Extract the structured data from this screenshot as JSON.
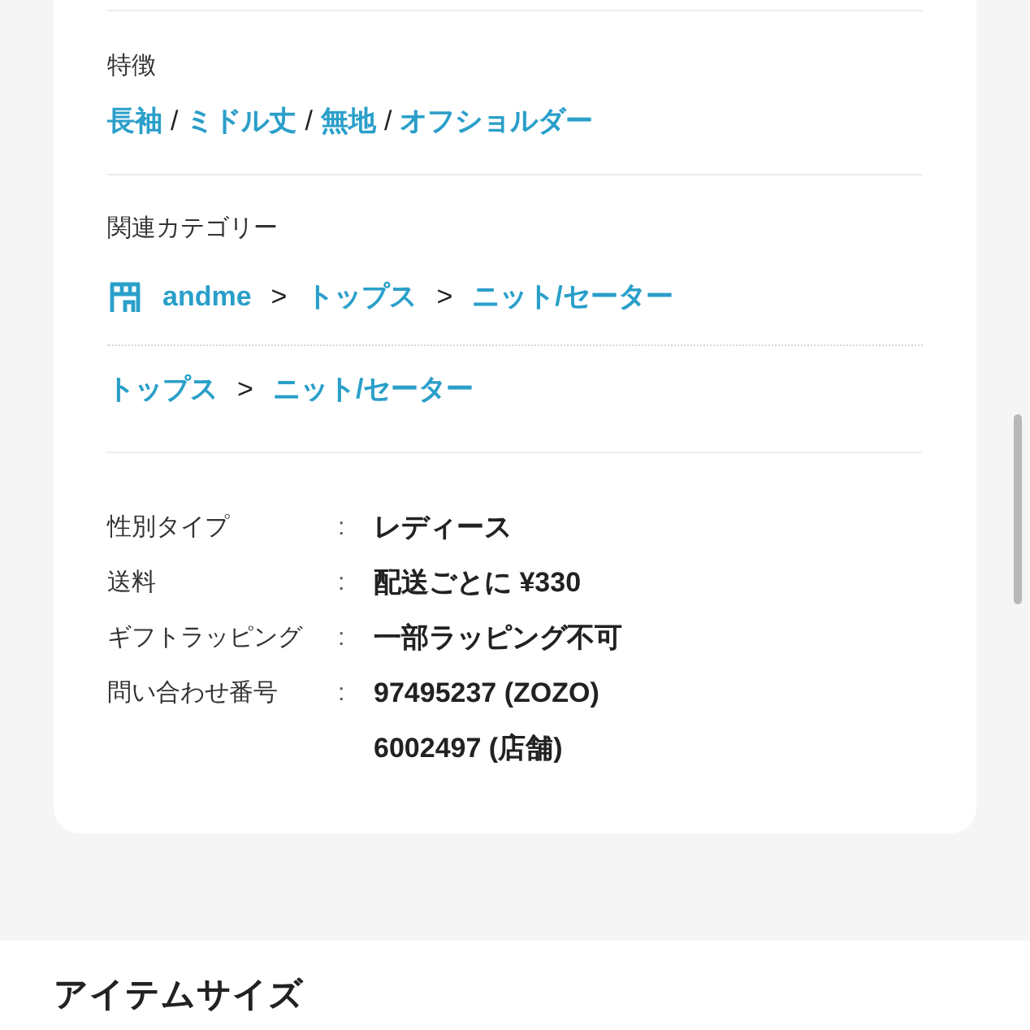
{
  "features": {
    "label": "特徴",
    "tags": [
      {
        "text": "長袖"
      },
      {
        "text": "ミドル丈"
      },
      {
        "text": "無地"
      },
      {
        "text": "オフショルダー"
      }
    ],
    "separators": [
      "/",
      "/",
      "/"
    ]
  },
  "related_categories": {
    "label": "関連カテゴリー",
    "paths": [
      {
        "kind": "shop",
        "items": [
          "andme",
          "トップス",
          "ニット/セーター"
        ],
        "separators": [
          ">",
          ">"
        ]
      },
      {
        "kind": "plain",
        "items": [
          "トップス",
          "ニット/セーター"
        ],
        "separators": [
          ">"
        ]
      }
    ]
  },
  "details": [
    {
      "label": "性別タイプ",
      "colon": ":",
      "values": [
        "レディース"
      ]
    },
    {
      "label": "送料",
      "colon": ":",
      "values": [
        "配送ごとに ¥330"
      ]
    },
    {
      "label": "ギフトラッピング",
      "colon": ":",
      "values": [
        "一部ラッピング不可"
      ]
    },
    {
      "label": "問い合わせ番号",
      "colon": ":",
      "values": [
        "97495237 (ZOZO)",
        "6002497 (店舗)"
      ]
    }
  ],
  "next_section": {
    "title": "アイテムサイズ"
  }
}
